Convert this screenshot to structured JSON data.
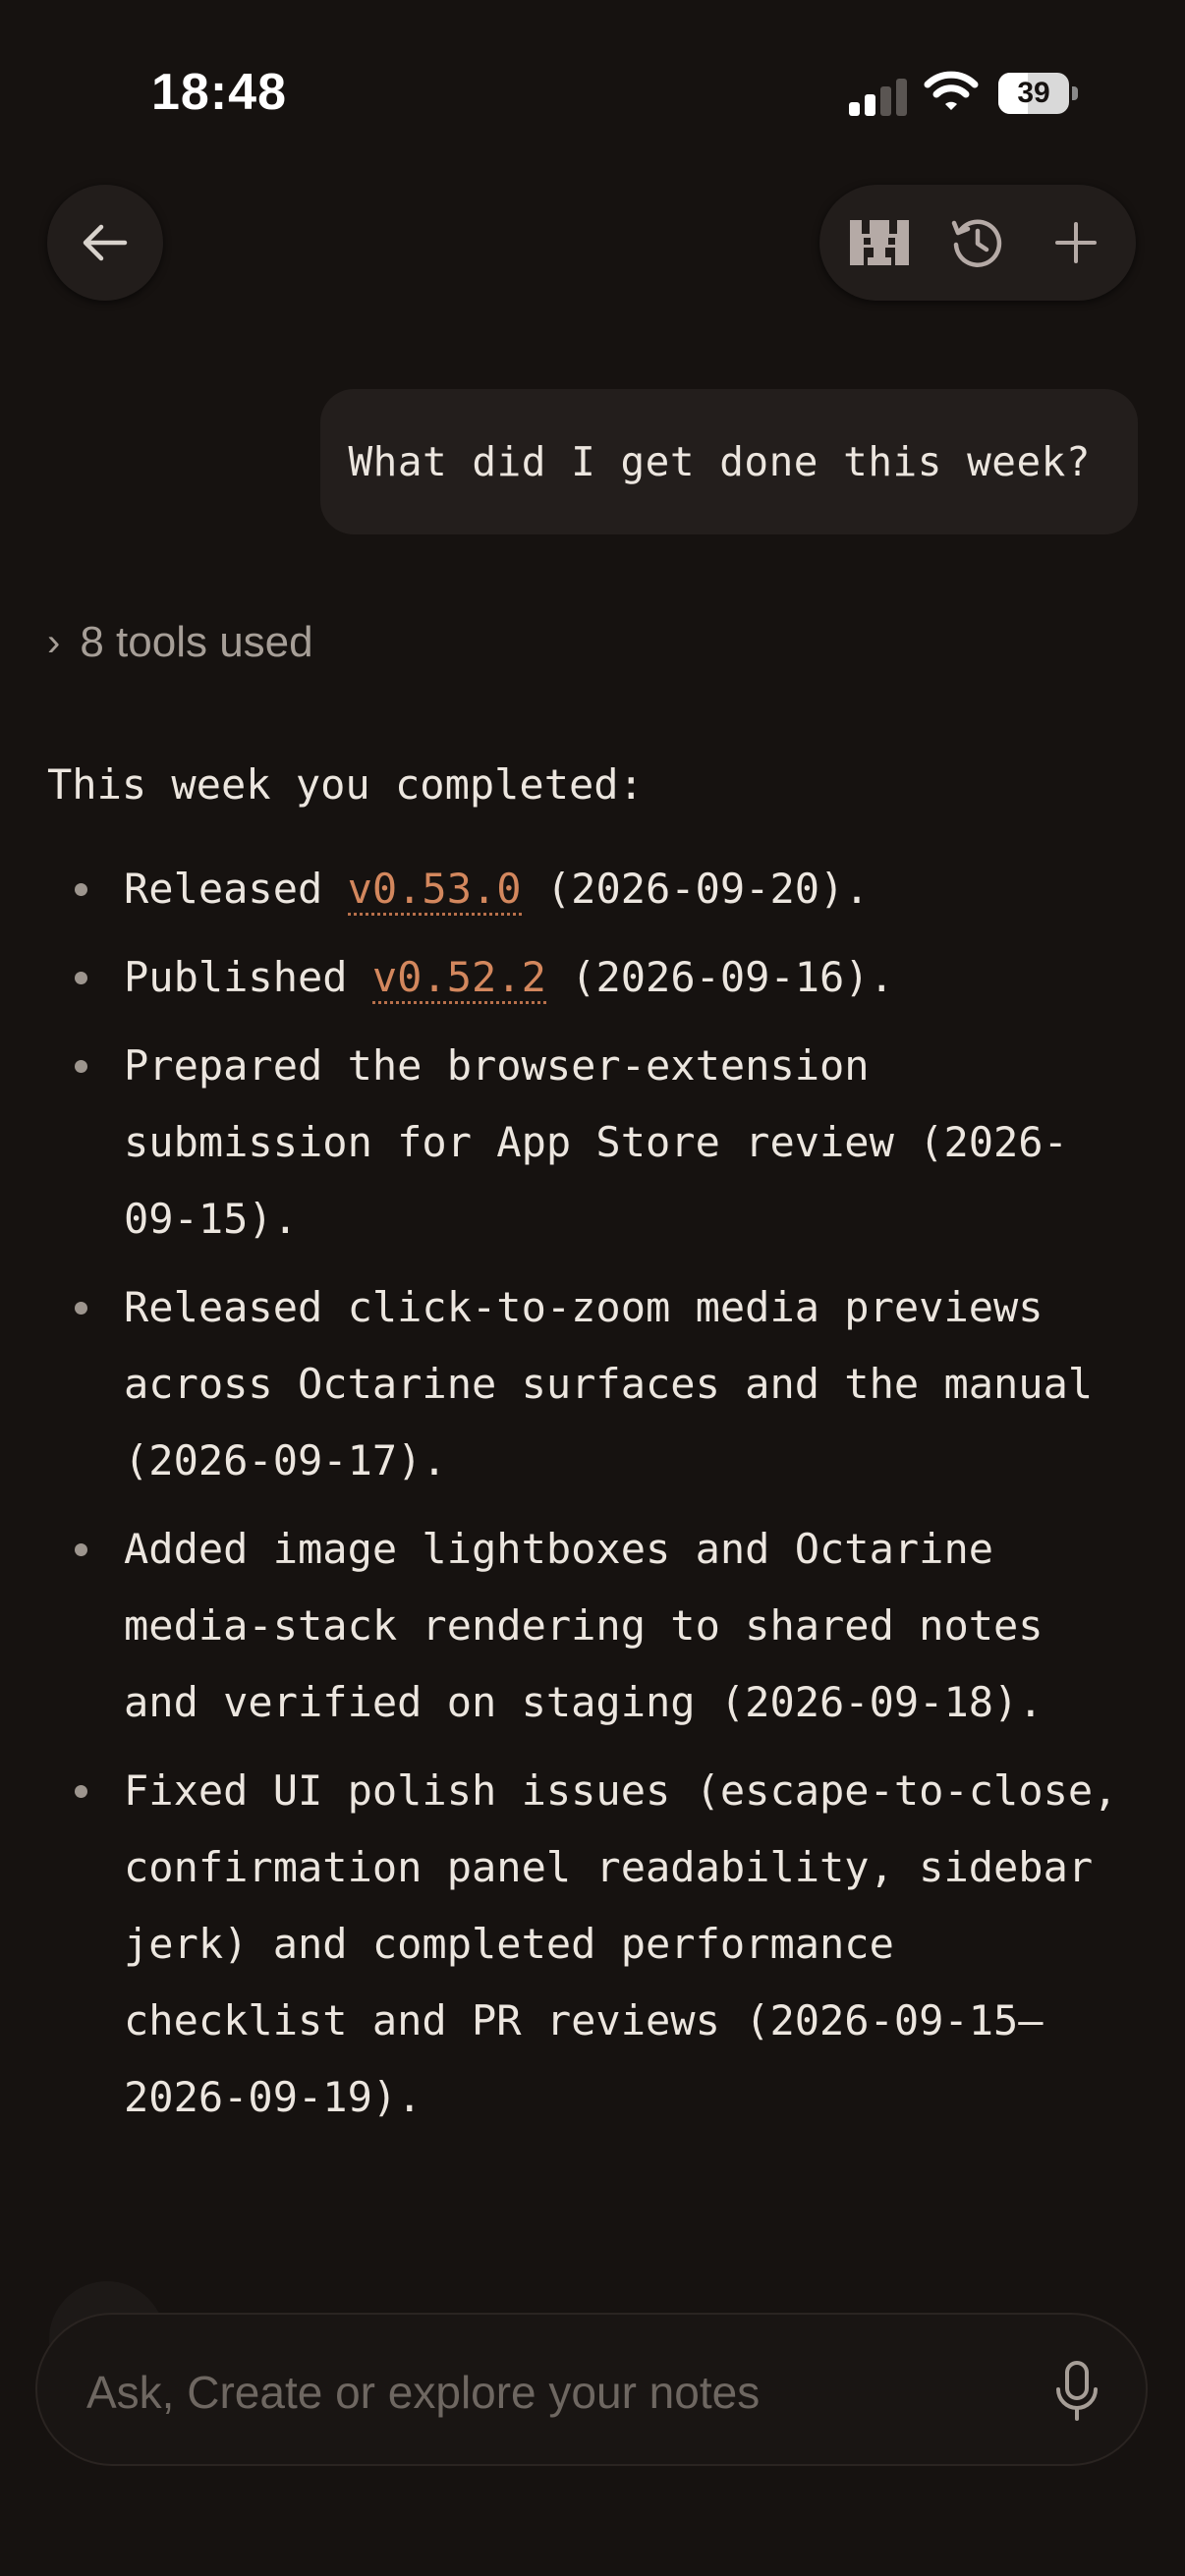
{
  "status_bar": {
    "time": "18:48",
    "battery_percent": "39",
    "signal_bars_active": 2,
    "signal_bars_total": 4
  },
  "nav": {
    "back_icon": "arrow-left-icon",
    "toolbar_icons": [
      "mascot-icon",
      "history-icon",
      "plus-icon"
    ]
  },
  "conversation": {
    "user_message": "What did I get done this week?",
    "tools_summary": "8 tools used",
    "assistant_intro": "This week you completed:",
    "items": [
      {
        "pre": "Released ",
        "link": "v0.53.0",
        "post": " (2026-09-20)."
      },
      {
        "pre": "Published ",
        "link": "v0.52.2",
        "post": " (2026-09-16)."
      },
      {
        "pre": "Prepared the browser-extension submission for App Store review (2026-09-15).",
        "link": "",
        "post": ""
      },
      {
        "pre": "Released click-to-zoom media previews across Octarine surfaces and the manual (2026-09-17).",
        "link": "",
        "post": ""
      },
      {
        "pre": "Added image lightboxes and Octarine media-stack rendering to shared notes and verified on staging (2026-09-18).",
        "link": "",
        "post": ""
      },
      {
        "pre": "Fixed UI polish issues (escape-to-close, confirmation panel readability, sidebar jerk) and completed performance checklist and PR reviews (2026-09-15–2026-09-19).",
        "link": "",
        "post": ""
      }
    ]
  },
  "composer": {
    "placeholder": "Ask, Create or explore your notes",
    "value": "",
    "mic_icon": "microphone-icon"
  },
  "colors": {
    "background": "#161210",
    "link": "#d3875d",
    "surface": "#221d1b"
  }
}
